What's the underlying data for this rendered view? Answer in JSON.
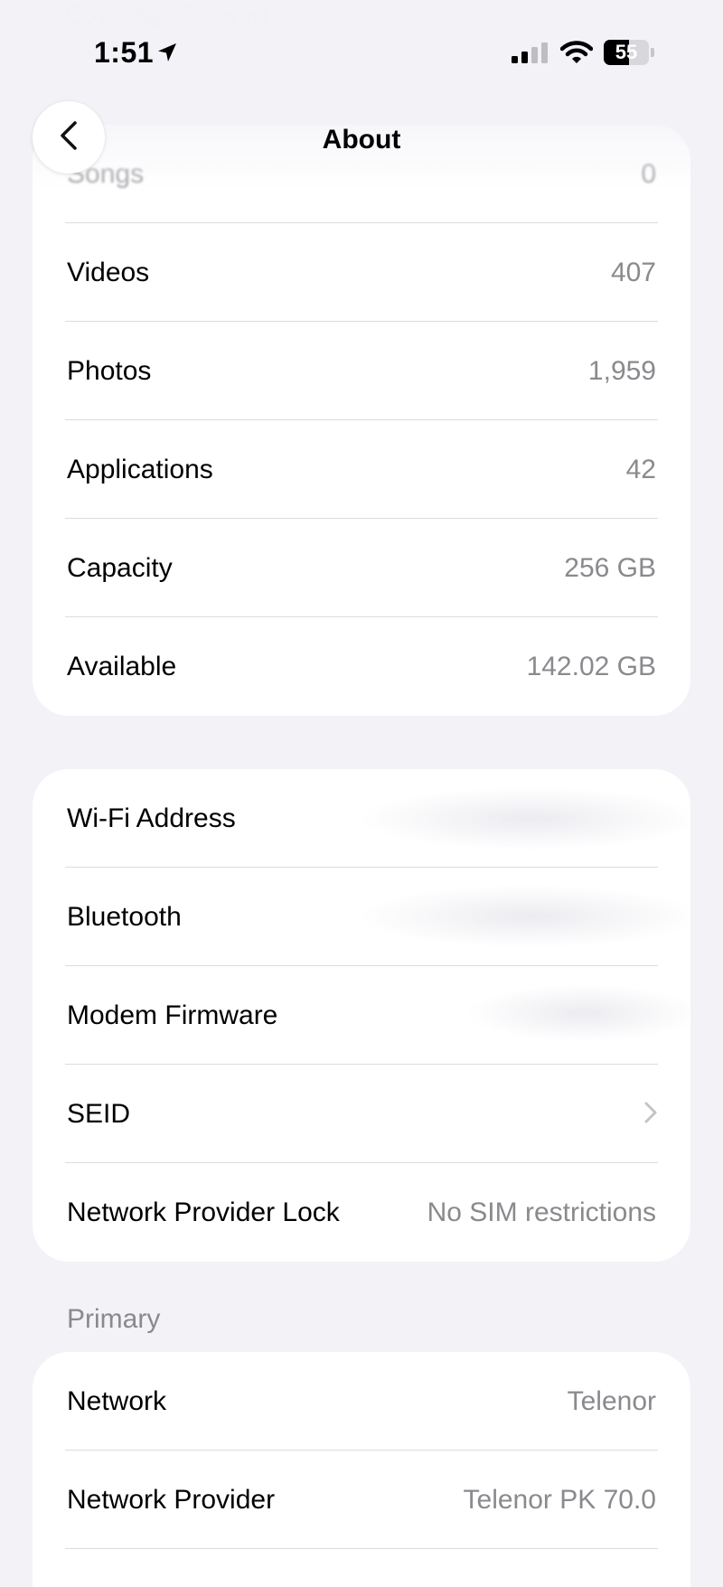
{
  "status_bar": {
    "time": "1:51",
    "battery_percent": "55",
    "icons": [
      "location-arrow-icon",
      "cellular-signal-icon",
      "wifi-icon",
      "battery-icon"
    ]
  },
  "background_faded_text": "Coverage Expired",
  "nav": {
    "title": "About",
    "back_icon": "chevron-left-icon"
  },
  "group1": {
    "rows": [
      {
        "label": "Songs",
        "value": "0"
      },
      {
        "label": "Videos",
        "value": "407"
      },
      {
        "label": "Photos",
        "value": "1,959"
      },
      {
        "label": "Applications",
        "value": "42"
      },
      {
        "label": "Capacity",
        "value": "256 GB"
      },
      {
        "label": "Available",
        "value": "142.02 GB"
      }
    ]
  },
  "group2": {
    "rows": [
      {
        "label": "Wi-Fi Address",
        "value": ""
      },
      {
        "label": "Bluetooth",
        "value": ""
      },
      {
        "label": "Modem Firmware",
        "value": ""
      },
      {
        "label": "SEID",
        "value": "",
        "icon": "chevron-right-icon"
      },
      {
        "label": "Network Provider Lock",
        "value": "No SIM restrictions"
      }
    ]
  },
  "section_primary": {
    "header": "Primary"
  },
  "group3": {
    "rows": [
      {
        "label": "Network",
        "value": "Telenor"
      },
      {
        "label": "Network Provider",
        "value": "Telenor PK 70.0"
      }
    ]
  },
  "colors": {
    "background": "#f2f2f7",
    "card": "#ffffff",
    "secondary_text": "#8a8a8e",
    "separator": "#dcdcdf"
  }
}
